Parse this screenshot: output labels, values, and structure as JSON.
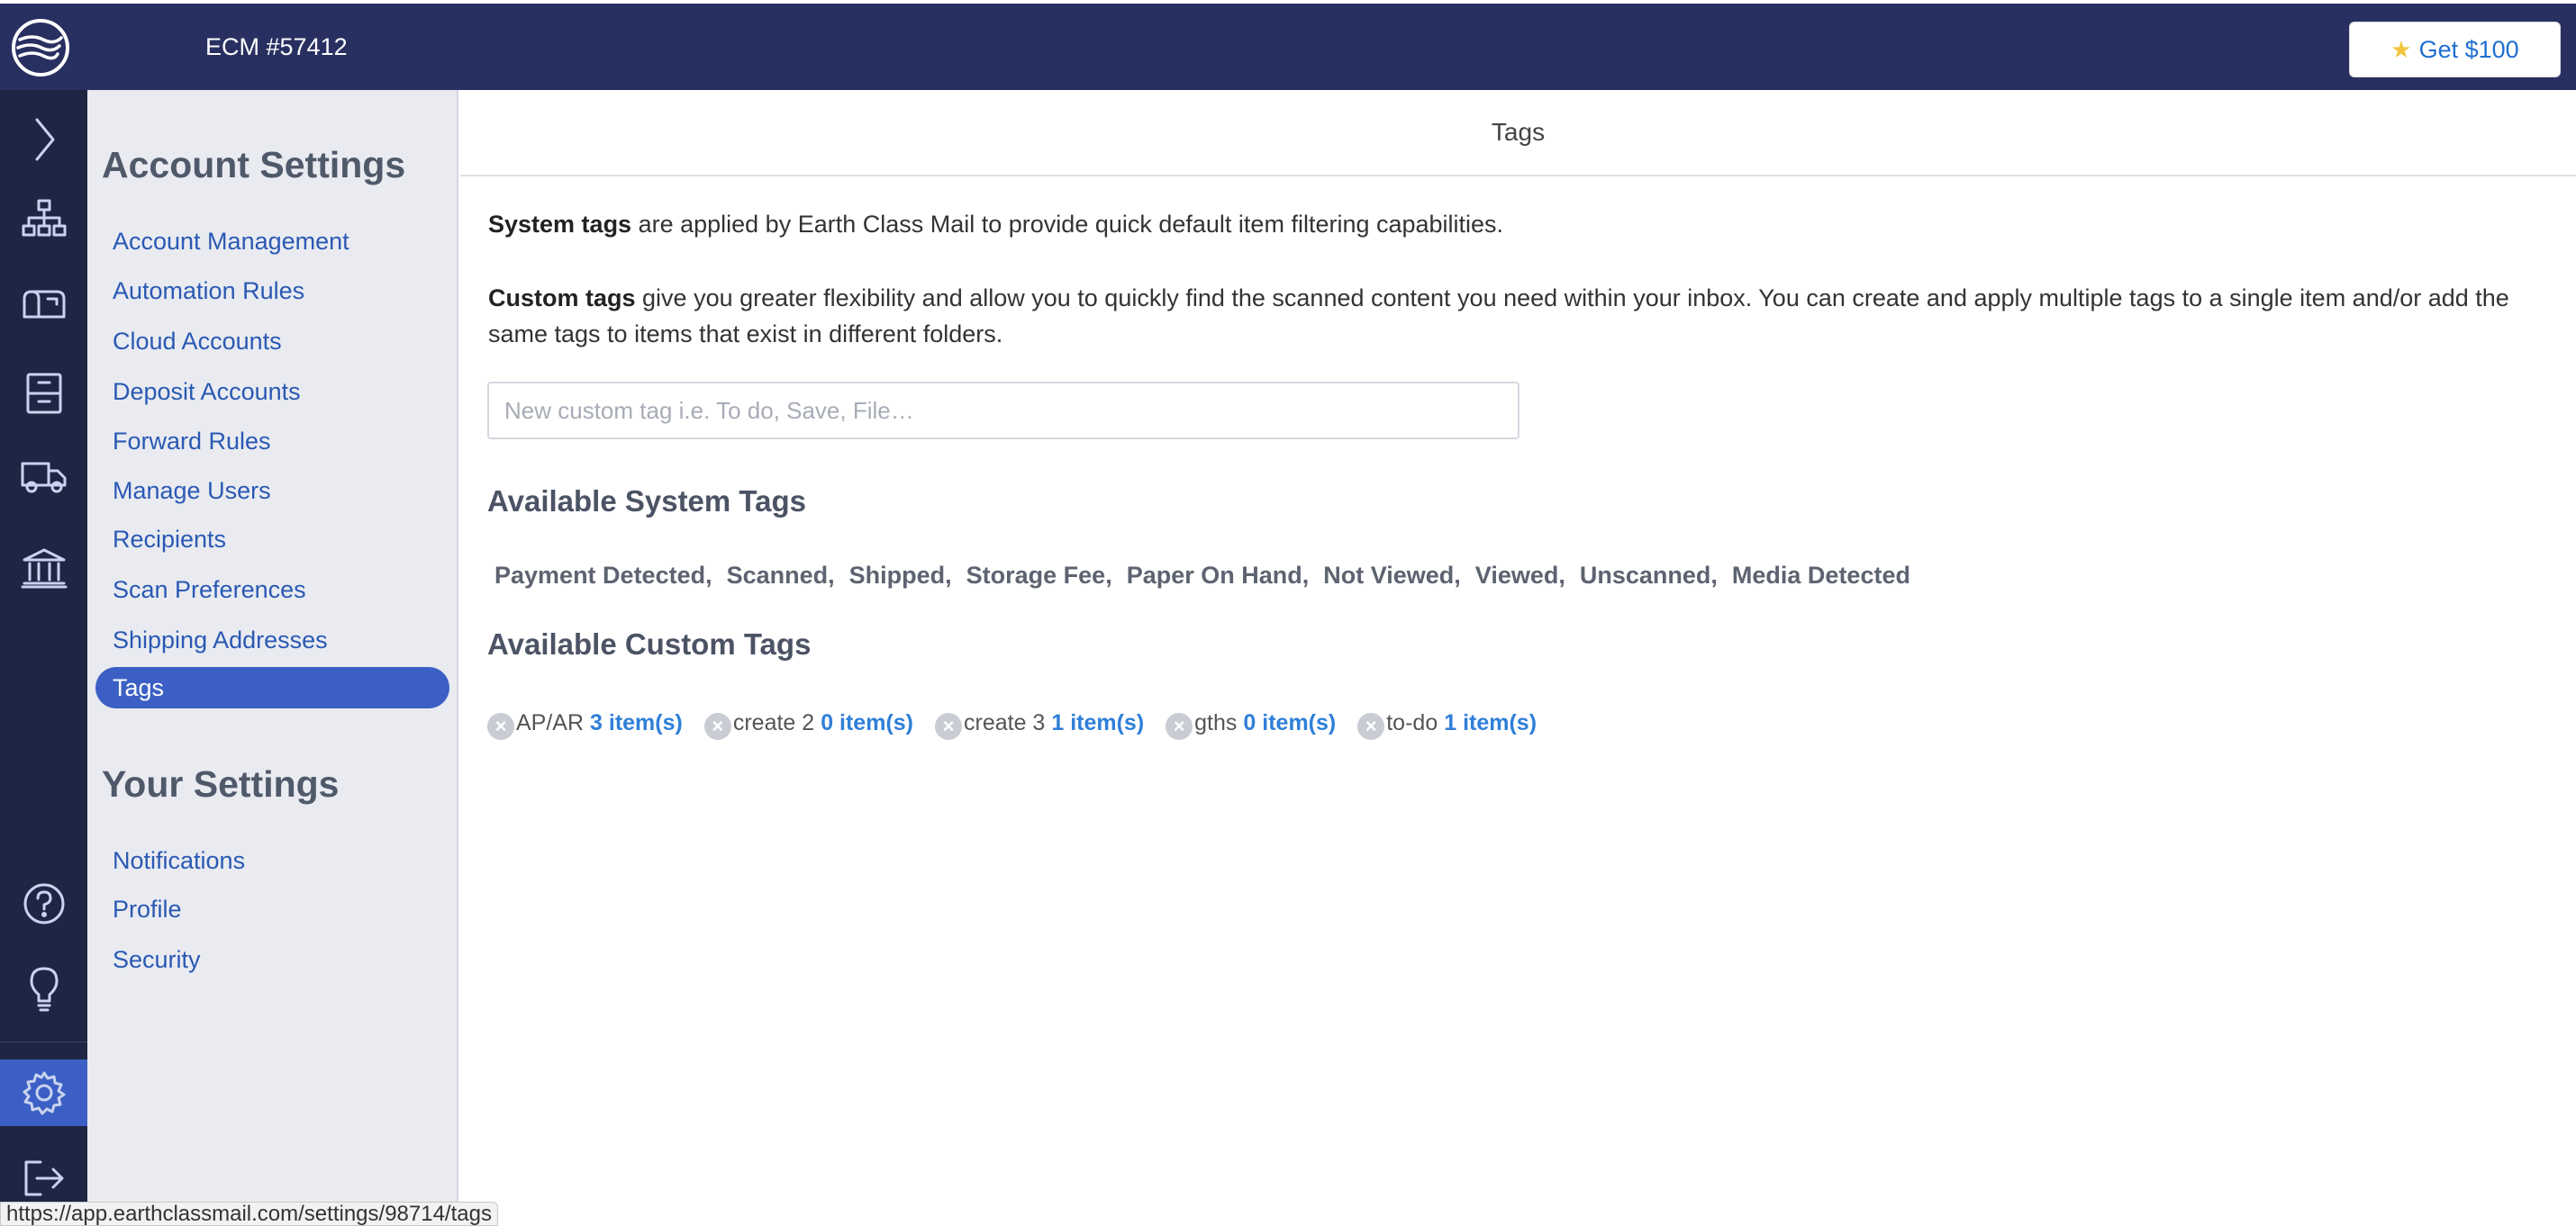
{
  "topbar": {
    "account_title": "ECM #57412",
    "promo_label": "Get $100",
    "icons": {
      "logo": "earth-class-mail-logo",
      "promo": "star-icon"
    }
  },
  "rail": {
    "icons": [
      "expand-chevron-icon",
      "sitemap-icon",
      "mailbox-icon",
      "filing-cabinet-icon",
      "delivery-truck-icon",
      "bank-icon",
      "help-icon",
      "lightbulb-icon",
      "gear-icon",
      "logout-icon"
    ],
    "active": "gear-icon"
  },
  "sidebar": {
    "account_heading": "Account Settings",
    "account_items": [
      "Account Management",
      "Automation Rules",
      "Cloud Accounts",
      "Deposit Accounts",
      "Forward Rules",
      "Manage Users",
      "Recipients",
      "Scan Preferences",
      "Shipping Addresses",
      "Tags"
    ],
    "active_item": "Tags",
    "your_heading": "Your Settings",
    "your_items": [
      "Notifications",
      "Profile",
      "Security"
    ]
  },
  "main": {
    "page_title": "Tags",
    "system_desc_bold": "System tags",
    "system_desc_rest": " are applied by Earth Class Mail to provide quick default item filtering capabilities.",
    "custom_desc_bold": "Custom tags",
    "custom_desc_rest": " give you greater flexibility and allow you to quickly find the scanned content you need within your inbox. You can create and apply multiple tags to a single item and/or add the same tags to items that exist in different folders.",
    "tag_input_placeholder": "New custom tag i.e. To do, Save, File…",
    "system_tags_heading": "Available System Tags",
    "system_tags": [
      "Payment Detected,",
      "Scanned,",
      "Shipped,",
      "Storage Fee,",
      "Paper On Hand,",
      "Not Viewed,",
      "Viewed,",
      "Unscanned,",
      "Media Detected"
    ],
    "custom_tags_heading": "Available Custom Tags",
    "custom_tags": [
      {
        "name": "AP/AR",
        "count": "3 item(s)"
      },
      {
        "name": "create 2",
        "count": "0 item(s)"
      },
      {
        "name": "create 3",
        "count": "1 item(s)"
      },
      {
        "name": "gths",
        "count": "0 item(s)"
      },
      {
        "name": "to-do",
        "count": "1 item(s)"
      }
    ]
  },
  "status_bar": {
    "url": "https://app.earthclassmail.com/settings/98714/tags"
  },
  "colors": {
    "topbar": "#283061",
    "rail": "#1f2644",
    "accent": "#3b5fc4",
    "link": "#2a59b3",
    "count": "#2f7fd8"
  }
}
